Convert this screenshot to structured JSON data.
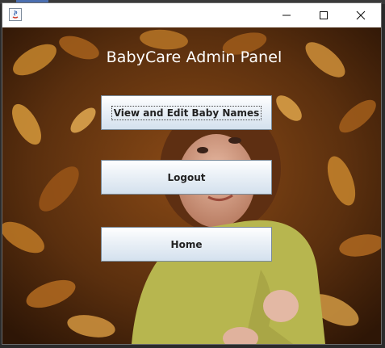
{
  "window": {
    "controls": {
      "minimize": "minimize-icon",
      "maximize": "maximize-icon",
      "close": "close-icon"
    }
  },
  "panel": {
    "title": "BabyCare Admin Panel",
    "buttons": {
      "view_edit_label": "View and Edit Baby Names",
      "logout_label": "Logout",
      "home_label": "Home"
    },
    "focused_button": "view_edit"
  },
  "colors": {
    "button_top": "#ffffff",
    "button_bottom": "#d4e1ee",
    "button_border": "#7a8a99",
    "title_text": "#ffffff",
    "background_main": "#6a3a12"
  }
}
